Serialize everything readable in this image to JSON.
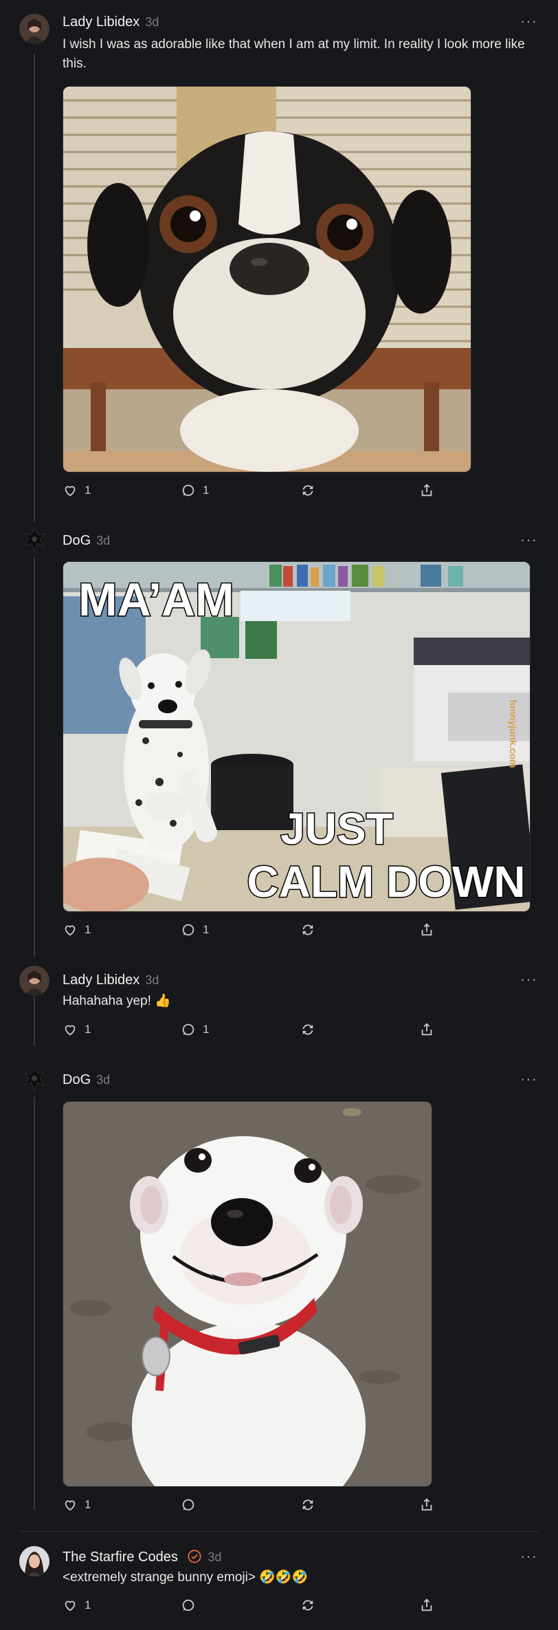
{
  "posts": [
    {
      "author": "Lady Libidex",
      "time": "3d",
      "text": "I wish I was as adorable like that when I am at my limit. In reality I look more like this.",
      "likes": "1",
      "replies": "1"
    },
    {
      "author": "DoG",
      "time": "3d",
      "meme_top": "MA’AM",
      "meme_bottom_1": "JUST",
      "meme_bottom_2": "CALM DOWN",
      "watermark": "funnyjunk.com",
      "likes": "1",
      "replies": "1"
    },
    {
      "author": "Lady Libidex",
      "time": "3d",
      "text": "Hahahaha yep! 👍",
      "likes": "1",
      "replies": "1"
    },
    {
      "author": "DoG",
      "time": "3d",
      "likes": "1",
      "replies": ""
    },
    {
      "author": "The Starfire Codes",
      "time": "3d",
      "text": "<extremely strange bunny emoji> 🤣🤣🤣",
      "likes": "1",
      "replies": ""
    }
  ],
  "icons": {
    "more": "more-horizontal-icon",
    "like": "heart-icon",
    "reply": "comment-icon",
    "repost": "repost-icon",
    "share": "share-icon",
    "verified": "verified-badge-icon"
  },
  "colors": {
    "background": "#17181b",
    "verified": "#e8663c"
  }
}
